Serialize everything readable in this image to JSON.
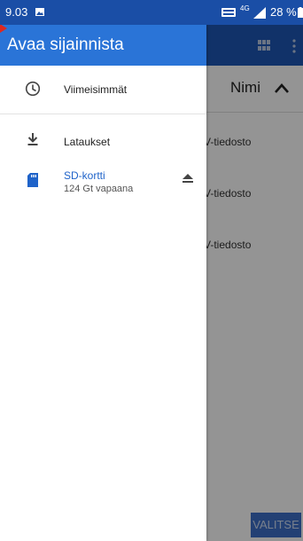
{
  "status": {
    "time": "9.03",
    "network": "4G",
    "battery": "28 %"
  },
  "background": {
    "sort_label": "Nimi",
    "files": [
      "SV-tiedosto",
      "SV-tiedosto",
      "SV-tiedosto"
    ],
    "select_label": "VALITSE"
  },
  "drawer": {
    "title": "Avaa sijainnista",
    "items": [
      {
        "label": "Viimeisimmät",
        "icon": "clock-icon"
      },
      {
        "label": "Lataukset",
        "icon": "download-icon"
      },
      {
        "label": "SD-kortti",
        "subtitle": "124 Gt vapaana",
        "icon": "sd-card-icon",
        "action_icon": "eject-icon"
      }
    ]
  },
  "colors": {
    "statusbar": "#1a4ea6",
    "drawer_header": "#2a74d7",
    "appbar": "#1e57b5",
    "accent": "#1f63c9"
  }
}
